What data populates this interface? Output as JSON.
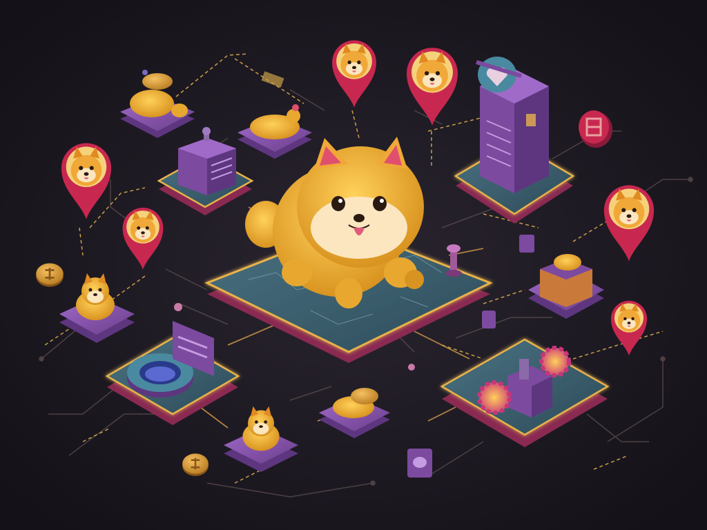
{
  "scene": {
    "colors": {
      "background": "#1b1820",
      "platform_top": "#3a5f6e",
      "platform_edge": "#c13a6f",
      "platform_glow": "#e8b24a",
      "purple_block": "#7c4a9e",
      "dog_body": "#f2b233",
      "dog_belly": "#f7e0a8",
      "pin_red": "#c8284f",
      "coin": "#e0a23c",
      "circuit_line": "#6a5a58",
      "arrow_gold": "#c9a04a"
    },
    "icons": {
      "central_dog": "shiba-dog-mascot",
      "pins": "shiba-map-pin",
      "coins": "crypto-coin",
      "server": "server-tower",
      "portal": "portal-ring",
      "gears": "gear-icon"
    }
  }
}
